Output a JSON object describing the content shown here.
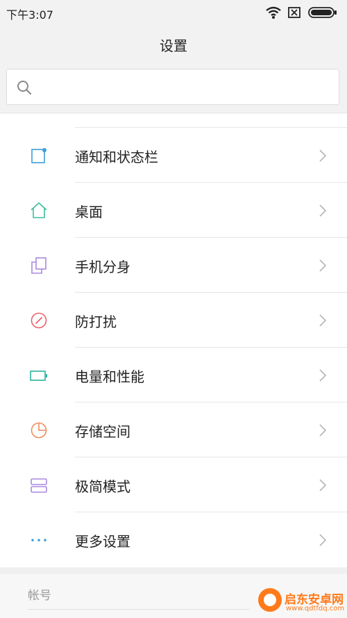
{
  "status_bar": {
    "time": "下午3:07"
  },
  "header": {
    "title": "设置"
  },
  "search": {
    "placeholder": "",
    "value": ""
  },
  "settings": [
    {
      "label": "通知和状态栏",
      "icon": "notification-icon",
      "color": "#3aa0d8"
    },
    {
      "label": "桌面",
      "icon": "home-icon",
      "color": "#3cbf9a"
    },
    {
      "label": "手机分身",
      "icon": "second-space-icon",
      "color": "#a989e0"
    },
    {
      "label": "防打扰",
      "icon": "do-not-disturb-icon",
      "color": "#e8616a"
    },
    {
      "label": "电量和性能",
      "icon": "battery-icon",
      "color": "#2bb39a"
    },
    {
      "label": "存储空间",
      "icon": "storage-icon",
      "color": "#f08a5d"
    },
    {
      "label": "极简模式",
      "icon": "simple-mode-icon",
      "color": "#a989e0"
    },
    {
      "label": "更多设置",
      "icon": "more-icon",
      "color": "#3aa0d8"
    }
  ],
  "account_section": {
    "label": "帐号"
  },
  "watermark": {
    "title": "启东安卓网",
    "url": "www.qdtfdq.com"
  }
}
